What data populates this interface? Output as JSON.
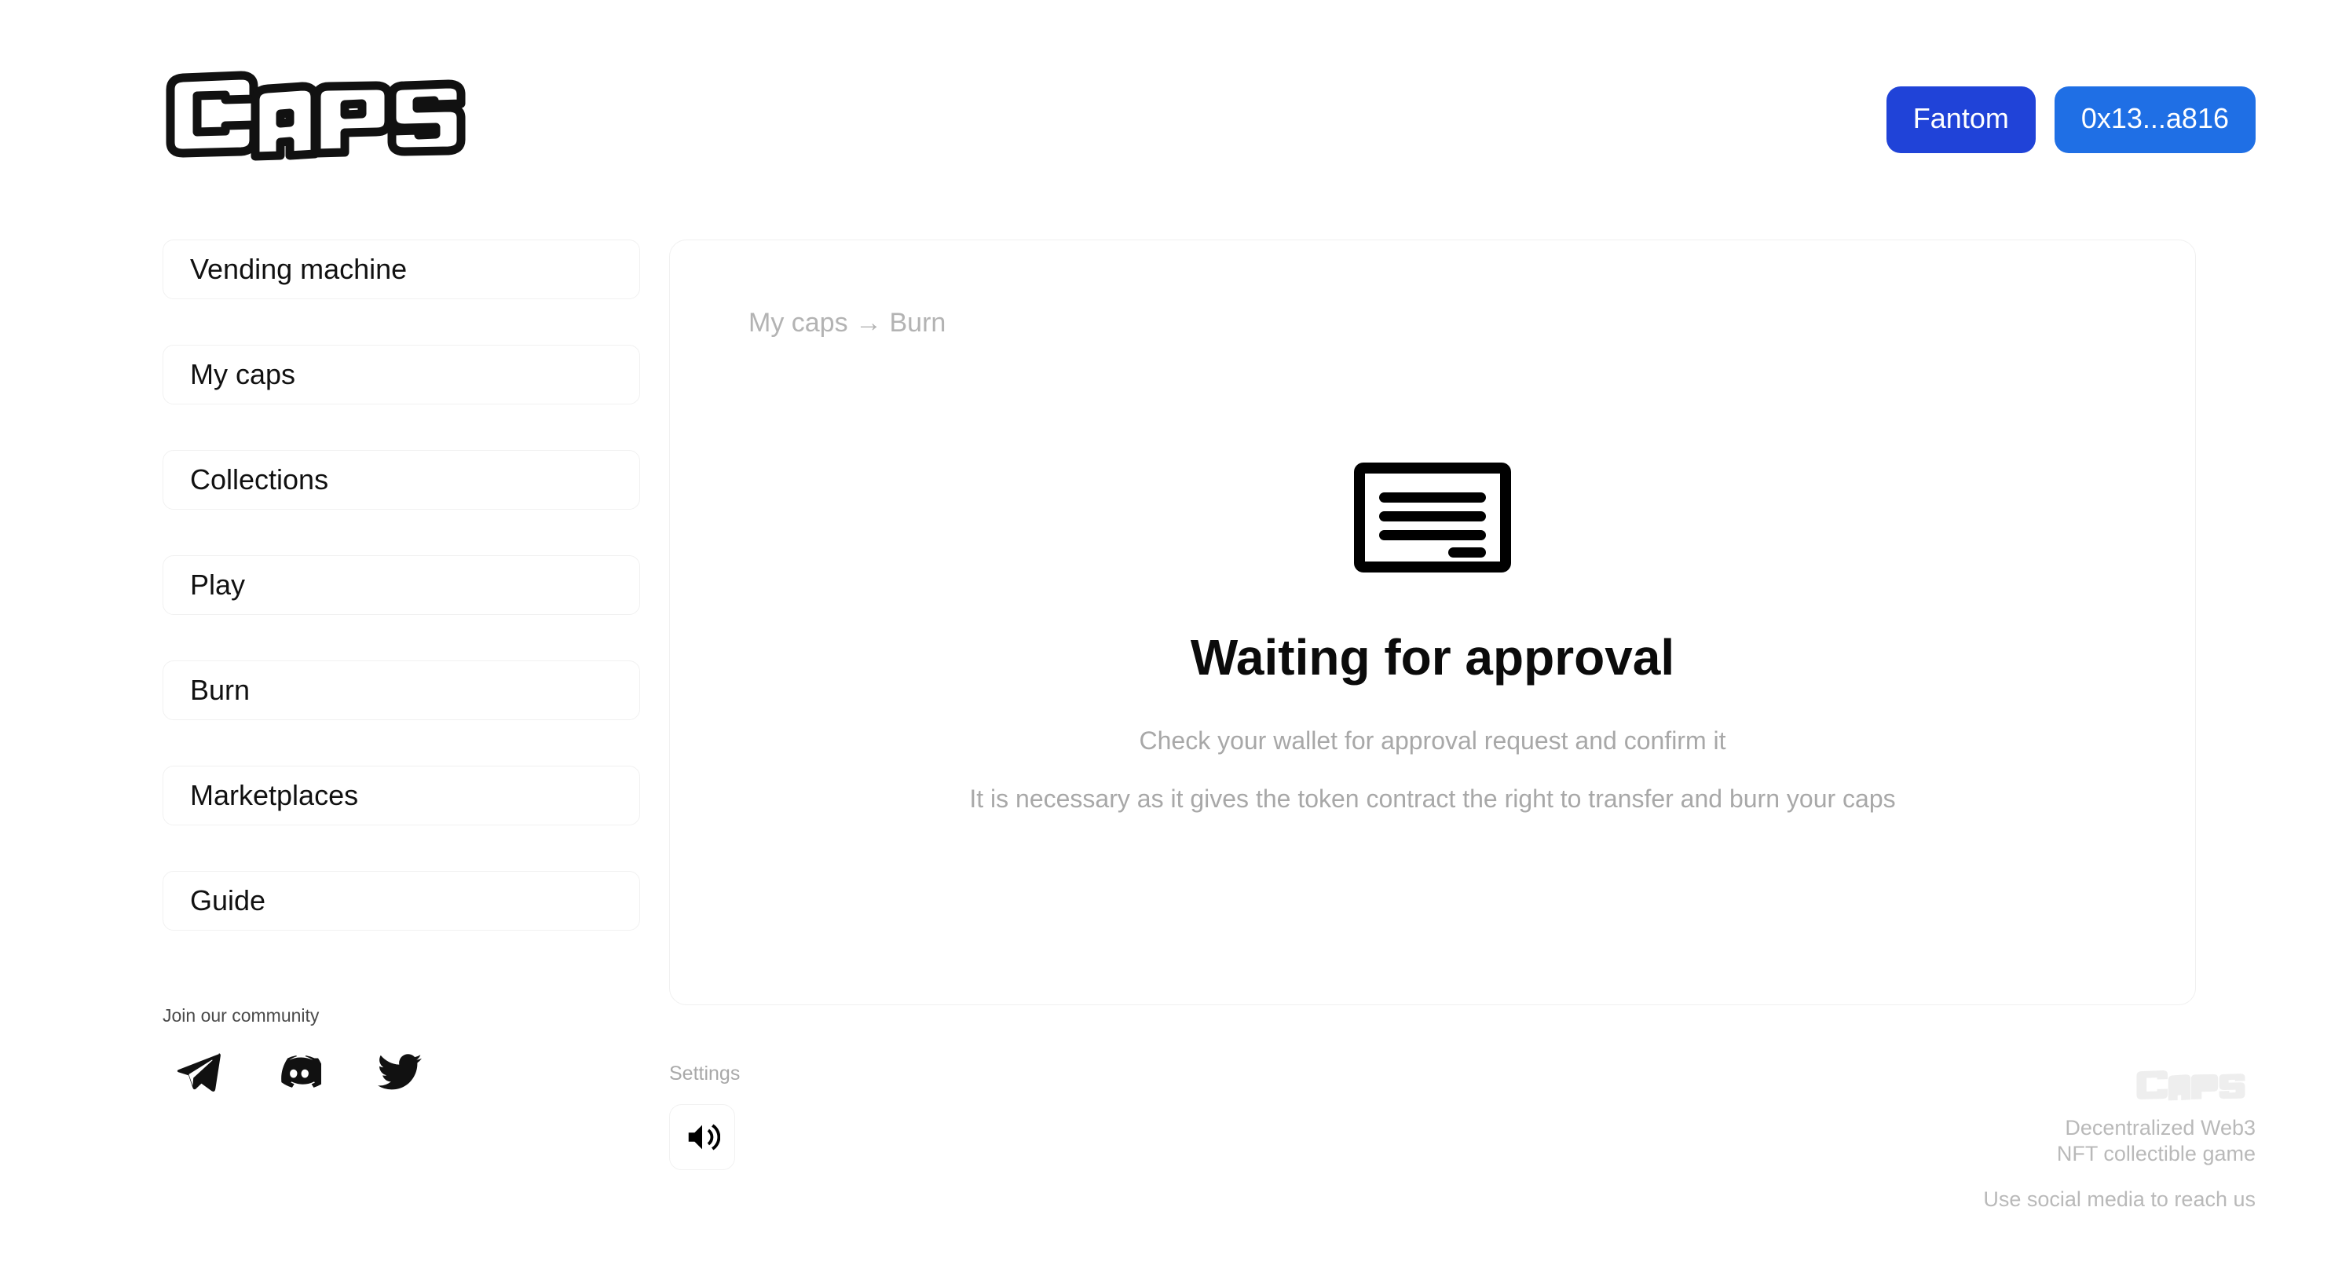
{
  "header": {
    "logo_text": "CAPS",
    "network_button": "Fantom",
    "wallet_button": "0x13...a816"
  },
  "sidebar": {
    "items": [
      {
        "label": "Vending machine"
      },
      {
        "label": "My caps"
      },
      {
        "label": "Collections"
      },
      {
        "label": "Play"
      },
      {
        "label": "Burn"
      },
      {
        "label": "Marketplaces"
      },
      {
        "label": "Guide"
      }
    ],
    "community_title": "Join our community",
    "socials": [
      {
        "name": "telegram",
        "label": "Telegram"
      },
      {
        "name": "discord",
        "label": "Discord"
      },
      {
        "name": "twitter",
        "label": "Twitter"
      }
    ]
  },
  "main": {
    "breadcrumb": "My caps → Burn",
    "breadcrumb_parent": "My caps",
    "breadcrumb_current": "Burn",
    "status_icon": "contract-document-icon",
    "title": "Waiting for approval",
    "description_1": "Check your wallet for approval request and confirm it",
    "description_2": "It is necessary as it gives the token contract the right to transfer and burn your caps"
  },
  "footer": {
    "settings_label": "Settings",
    "sound_icon": "speaker-on-icon",
    "watermark_text": "CAPS",
    "tagline_line_1": "Decentralized Web3",
    "tagline_line_2": "NFT collectible game",
    "reach_line": "Use social media to reach us"
  },
  "colors": {
    "network_button": "#2043d8",
    "wallet_button": "#1f6fe5",
    "page_background": "#ffffff",
    "card_border": "#f0f0f0",
    "muted_text": "#b3b3b3",
    "title_text": "#0b0b0b"
  }
}
